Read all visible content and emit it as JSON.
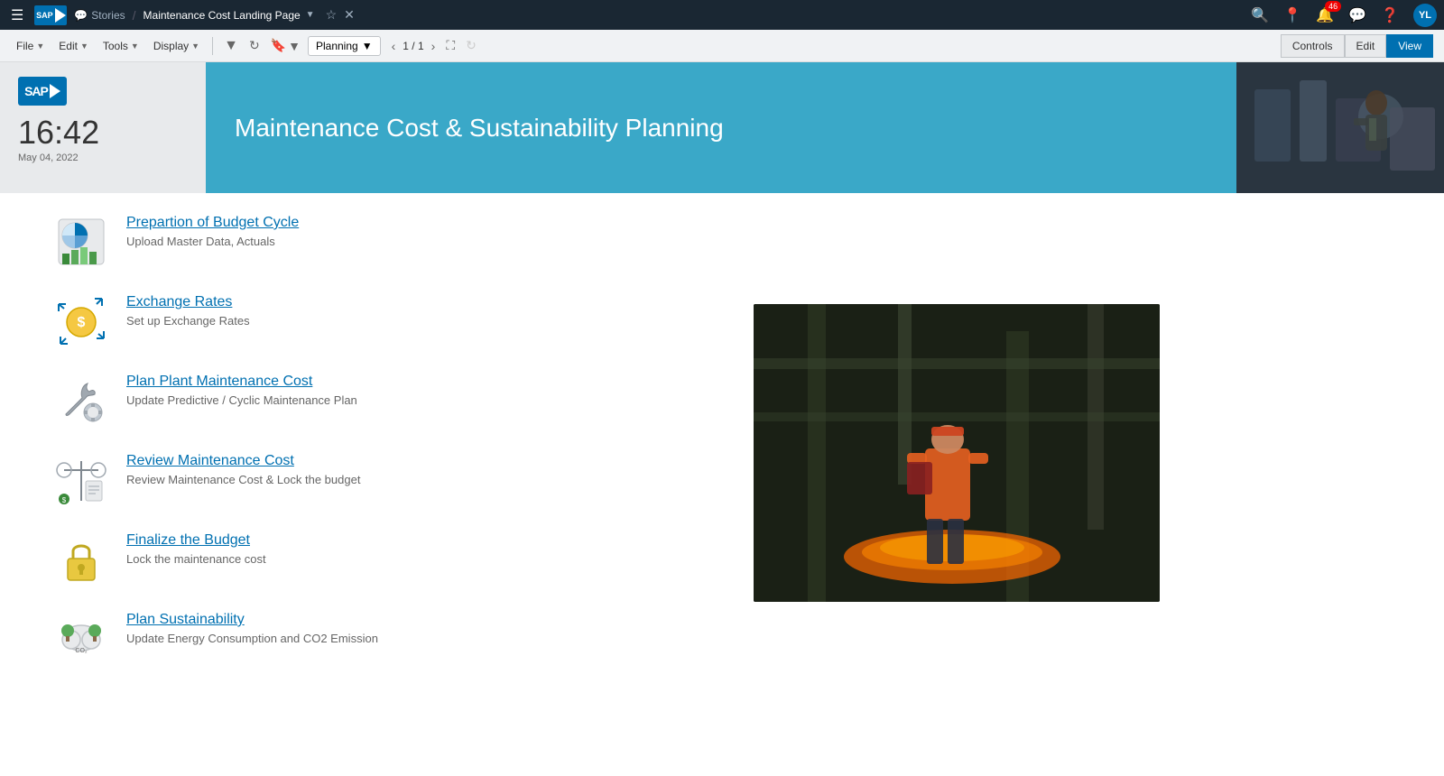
{
  "topnav": {
    "sap_label": "SAP",
    "stories_label": "Stories",
    "page_title": "Maintenance Cost Landing Page",
    "avatar_initials": "YL",
    "notification_count": "46"
  },
  "toolbar": {
    "file_label": "File",
    "edit_label": "Edit",
    "tools_label": "Tools",
    "display_label": "Display",
    "planning_label": "Planning",
    "page_current": "1",
    "page_total": "1",
    "controls_label": "Controls",
    "edit_view_label": "Edit",
    "view_label": "View"
  },
  "header": {
    "clock_time": "16:42",
    "clock_date": "May 04, 2022",
    "title": "Maintenance Cost & Sustainability Planning"
  },
  "menu_items": [
    {
      "id": "budget-cycle",
      "link": "Prepartion of Budget Cycle",
      "desc": "Upload Master Data, Actuals"
    },
    {
      "id": "exchange-rates",
      "link": "Exchange Rates",
      "desc": "Set up Exchange Rates"
    },
    {
      "id": "plan-maintenance",
      "link": "Plan Plant Maintenance Cost",
      "desc": "Update Predictive / Cyclic Maintenance Plan"
    },
    {
      "id": "review-maintenance",
      "link": "Review Maintenance Cost",
      "desc": "Review Maintenance Cost & Lock the budget"
    },
    {
      "id": "finalize-budget",
      "link": "Finalize the Budget",
      "desc": "Lock the maintenance cost"
    },
    {
      "id": "plan-sustainability",
      "link": "Plan Sustainability",
      "desc": "Update Energy Consumption and CO2 Emission"
    }
  ]
}
